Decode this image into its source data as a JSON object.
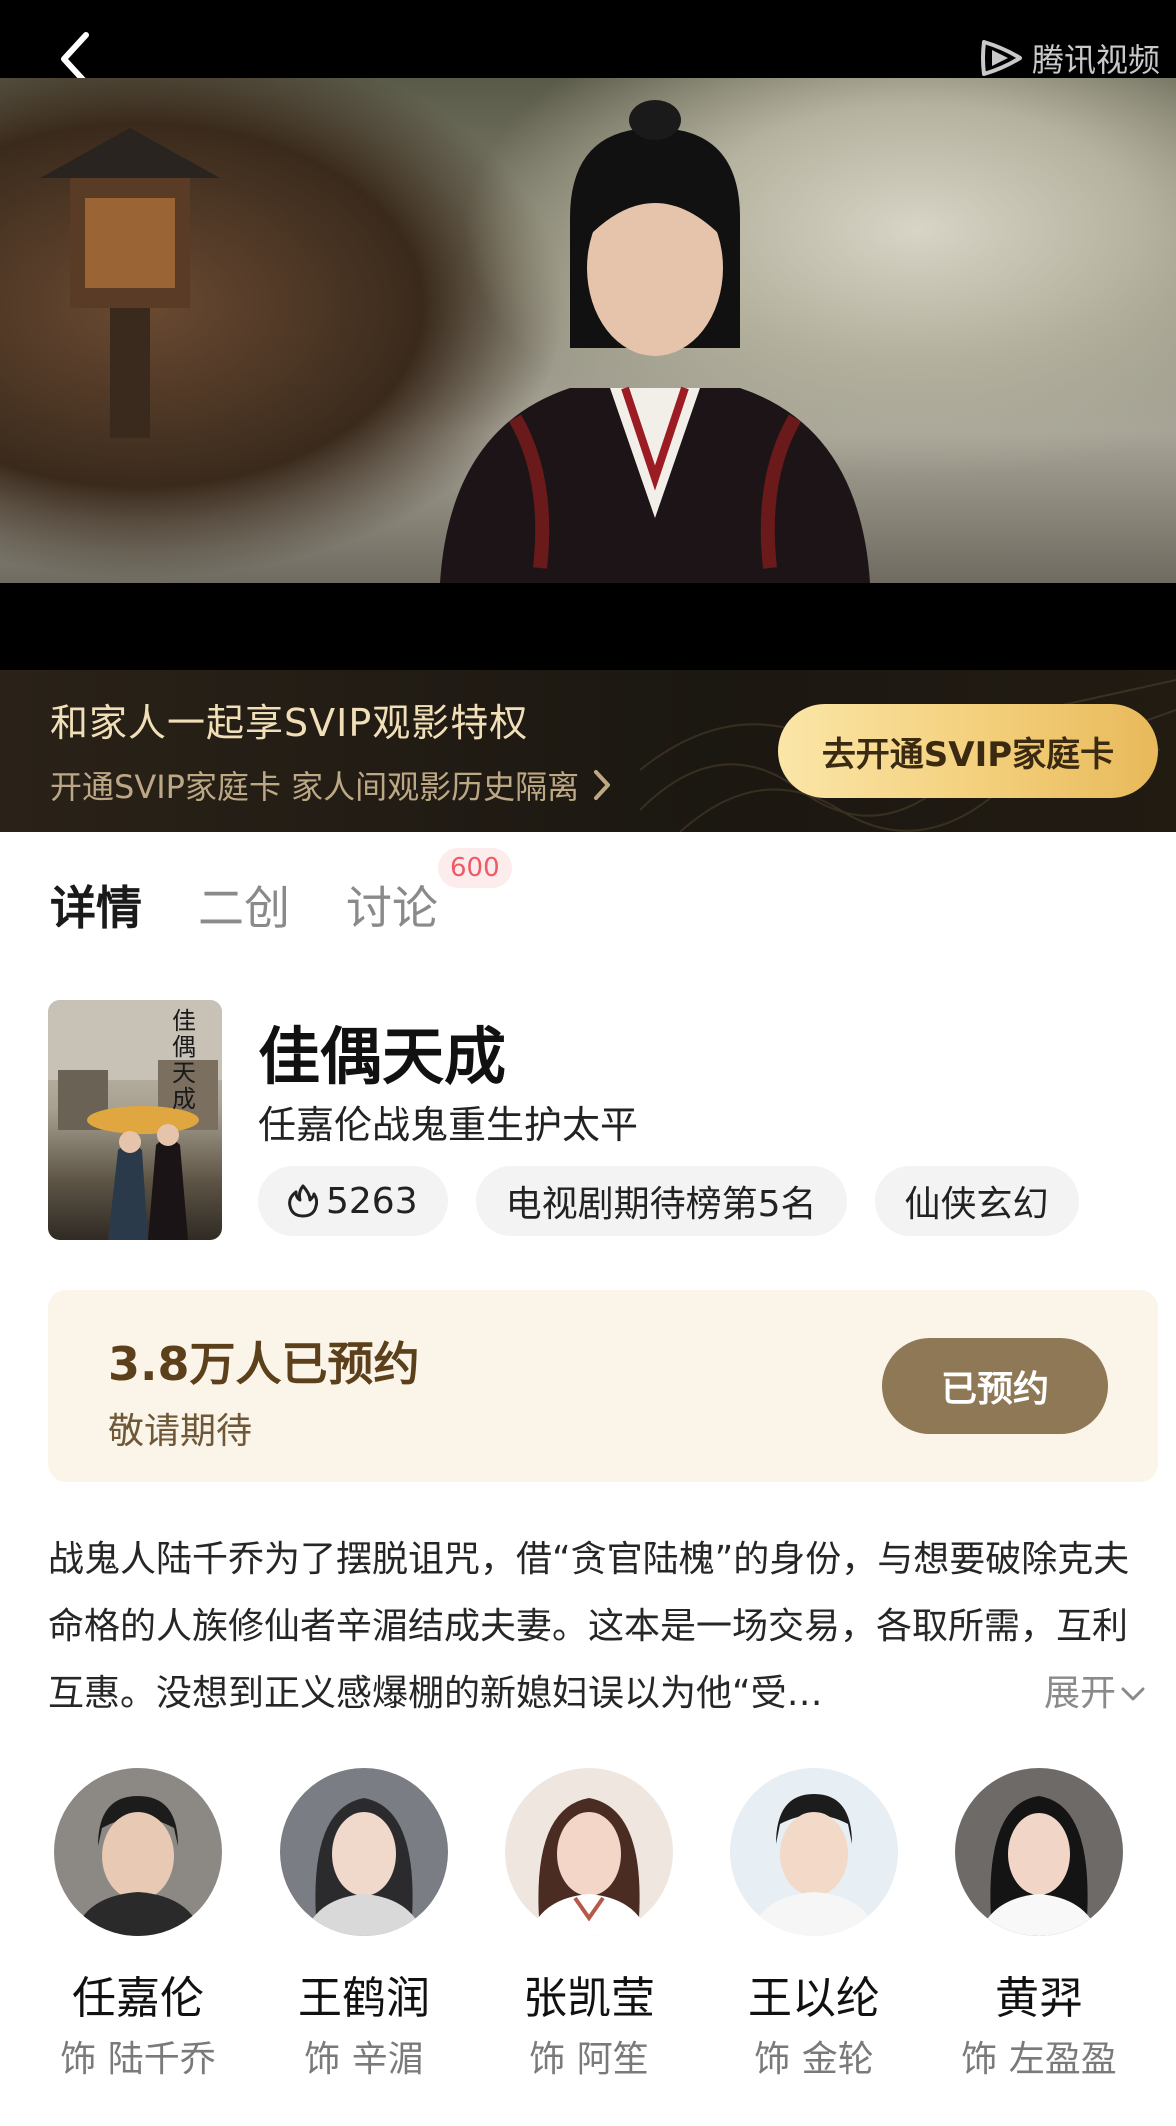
{
  "player": {
    "logo_text": "腾讯视频",
    "back_icon": "chevron-left-icon",
    "logo_icon": "tencent-video-play-icon"
  },
  "svip_banner": {
    "title": "和家人一起享SVIP观影特权",
    "subtitle": "开通SVIP家庭卡 家人间观影历史隔离",
    "button_label": "去开通SVIP家庭卡"
  },
  "tabs": [
    {
      "label": "详情",
      "active": true
    },
    {
      "label": "二创",
      "active": false
    },
    {
      "label": "讨论",
      "active": false,
      "badge": "600"
    }
  ],
  "show": {
    "title": "佳偶天成",
    "tagline": "任嘉伦战鬼重生护太平",
    "poster_title": "佳偶天成",
    "chips": [
      {
        "icon": "flame-icon",
        "label": "5263"
      },
      {
        "label": "电视剧期待榜第5名"
      },
      {
        "label": "仙侠玄幻"
      }
    ]
  },
  "reservation": {
    "count_text": "3.8万人已预约",
    "note": "敬请期待",
    "button_label": "已预约"
  },
  "synopsis": {
    "text": "战鬼人陆千乔为了摆脱诅咒，借“贪官陆槐”的身份，与想要破除克夫命格的人族修仙者辛湄结成夫妻。这本是一场交易，各取所需，互利互惠。没想到正义感爆棚的新媳妇误以为他“受…",
    "expand_label": "展开"
  },
  "cast": [
    {
      "name": "任嘉伦",
      "role": "饰 陆千乔"
    },
    {
      "name": "王鹤润",
      "role": "饰 辛湄"
    },
    {
      "name": "张凯莹",
      "role": "饰 阿笙"
    },
    {
      "name": "王以纶",
      "role": "饰 金轮"
    },
    {
      "name": "黄羿",
      "role": "饰 左盈盈"
    }
  ],
  "colors": {
    "svip_gold": "#f3cf7b",
    "reserve_bg": "#fbf5e9",
    "reserve_button": "#8f7856",
    "badge_red": "#f05a64"
  }
}
